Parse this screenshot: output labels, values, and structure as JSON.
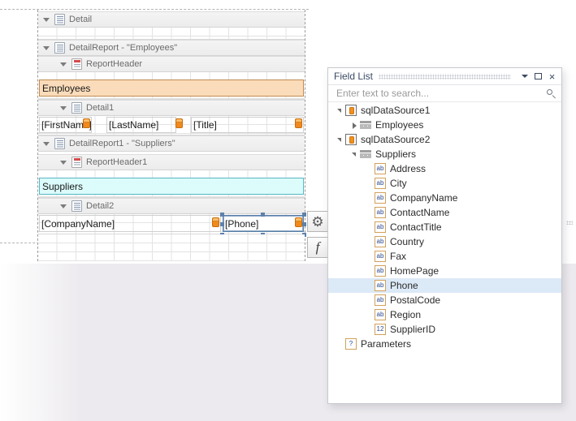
{
  "report_designer": {
    "bands": [
      {
        "id": "detail",
        "label": "Detail",
        "icon": "detail-band-icon",
        "level": 1,
        "expanded": true
      },
      {
        "id": "detailreport",
        "label": "DetailReport - \"Employees\"",
        "icon": "detail-report-band-icon",
        "level": 1,
        "expanded": true
      },
      {
        "id": "reportheader",
        "label": "ReportHeader",
        "icon": "report-header-band-icon",
        "level": 2,
        "expanded": true
      },
      {
        "id": "detail1",
        "label": "Detail1",
        "icon": "detail-band-icon",
        "level": 2,
        "expanded": true
      },
      {
        "id": "detailreport1",
        "label": "DetailReport1 - \"Suppliers\"",
        "icon": "detail-report-band-icon",
        "level": 1,
        "expanded": true
      },
      {
        "id": "reportheader1",
        "label": "ReportHeader1",
        "icon": "report-header-band-icon",
        "level": 2,
        "expanded": true
      },
      {
        "id": "detail2",
        "label": "Detail2",
        "icon": "detail-band-icon",
        "level": 2,
        "expanded": true
      }
    ],
    "controls": {
      "employees_title": "Employees",
      "suppliers_title": "Suppliers",
      "first_name": "[FirstName]",
      "last_name": "[LastName]",
      "title_field": "[Title]",
      "company_name": "[CompanyName]",
      "phone": "[Phone]"
    },
    "selected_control": "[Phone]",
    "smart_tag_buttons": [
      {
        "id": "smart-tag",
        "glyph": "⚙"
      },
      {
        "id": "expression-editor",
        "glyph": "f"
      }
    ],
    "colors": {
      "employees_header_bg": "#fbdcba",
      "suppliers_header_bg": "#dcfbfb",
      "selection_border": "#5a7fa8",
      "binding_badge": "#f08a1e"
    }
  },
  "field_list": {
    "title": "Field List",
    "buttons": {
      "menu": "chevron-down",
      "maximize": "maximize",
      "close": "×"
    },
    "search": {
      "value": "",
      "placeholder": "Enter text to search..."
    },
    "tree": [
      {
        "label": "sqlDataSource1",
        "icon": "datasource-icon",
        "indent": 0,
        "arrow": "expanded",
        "selected": false
      },
      {
        "label": "Employees",
        "icon": "table-icon",
        "indent": 1,
        "arrow": "collapsed",
        "selected": false
      },
      {
        "label": "sqlDataSource2",
        "icon": "datasource-icon",
        "indent": 0,
        "arrow": "expanded",
        "selected": false
      },
      {
        "label": "Suppliers",
        "icon": "table-icon",
        "indent": 1,
        "arrow": "expanded",
        "selected": false
      },
      {
        "label": "Address",
        "icon": "string-field-icon",
        "indent": 2,
        "arrow": "none",
        "selected": false
      },
      {
        "label": "City",
        "icon": "string-field-icon",
        "indent": 2,
        "arrow": "none",
        "selected": false
      },
      {
        "label": "CompanyName",
        "icon": "string-field-icon",
        "indent": 2,
        "arrow": "none",
        "selected": false
      },
      {
        "label": "ContactName",
        "icon": "string-field-icon",
        "indent": 2,
        "arrow": "none",
        "selected": false
      },
      {
        "label": "ContactTitle",
        "icon": "string-field-icon",
        "indent": 2,
        "arrow": "none",
        "selected": false
      },
      {
        "label": "Country",
        "icon": "string-field-icon",
        "indent": 2,
        "arrow": "none",
        "selected": false
      },
      {
        "label": "Fax",
        "icon": "string-field-icon",
        "indent": 2,
        "arrow": "none",
        "selected": false
      },
      {
        "label": "HomePage",
        "icon": "string-field-icon",
        "indent": 2,
        "arrow": "none",
        "selected": false
      },
      {
        "label": "Phone",
        "icon": "string-field-icon",
        "indent": 2,
        "arrow": "none",
        "selected": true
      },
      {
        "label": "PostalCode",
        "icon": "string-field-icon",
        "indent": 2,
        "arrow": "none",
        "selected": false
      },
      {
        "label": "Region",
        "icon": "string-field-icon",
        "indent": 2,
        "arrow": "none",
        "selected": false
      },
      {
        "label": "SupplierID",
        "icon": "numeric-field-icon",
        "indent": 2,
        "arrow": "none",
        "selected": false
      },
      {
        "label": "Parameters",
        "icon": "parameters-icon",
        "indent": 0,
        "arrow": "none",
        "selected": false
      }
    ],
    "icon_glyphs": {
      "string-field-icon": "ab",
      "numeric-field-icon": "12",
      "parameters-icon": "?"
    }
  }
}
